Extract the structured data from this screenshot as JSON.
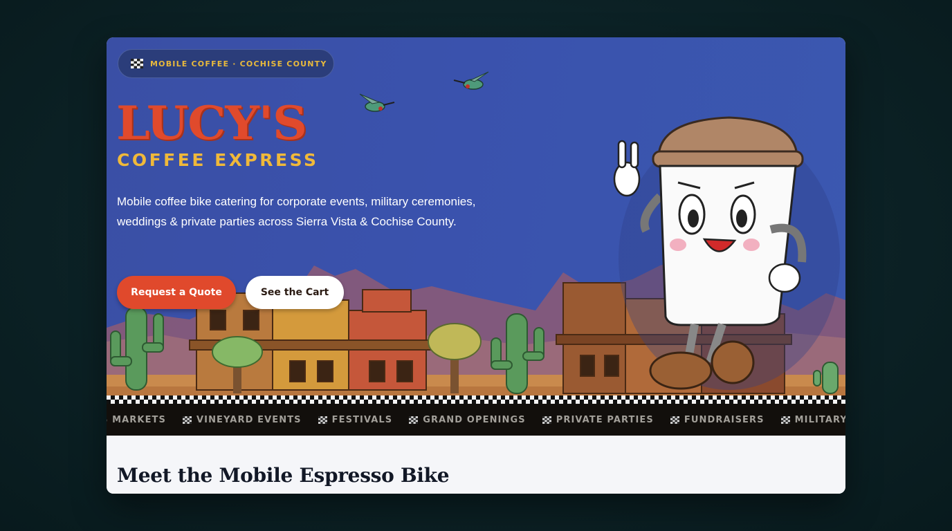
{
  "badge": {
    "icon": "checkered-flag-icon",
    "text": "MOBILE COFFEE · COCHISE COUNTY"
  },
  "brand": {
    "title": "LUCY'S",
    "subtitle": "COFFEE EXPRESS"
  },
  "intro": "Mobile coffee bike catering for corporate events, military ceremonies, weddings & private parties across Sierra Vista & Cochise County.",
  "buttons": {
    "quote": "Request a Quote",
    "cart": "See the Cart"
  },
  "ticker": [
    "S MARKETS",
    "VINEYARD EVENTS",
    "FESTIVALS",
    "GRAND OPENINGS",
    "PRIVATE PARTIES",
    "FUNDRAISERS",
    "MILITARY"
  ],
  "section": {
    "title": "Meet the Mobile Espresso Bike"
  },
  "colors": {
    "hero_blue": "#3a52ad",
    "accent_red": "#e0492c",
    "accent_gold": "#f0b93a",
    "ticker_bg": "#120f0c",
    "page_bg": "#0c2226"
  }
}
